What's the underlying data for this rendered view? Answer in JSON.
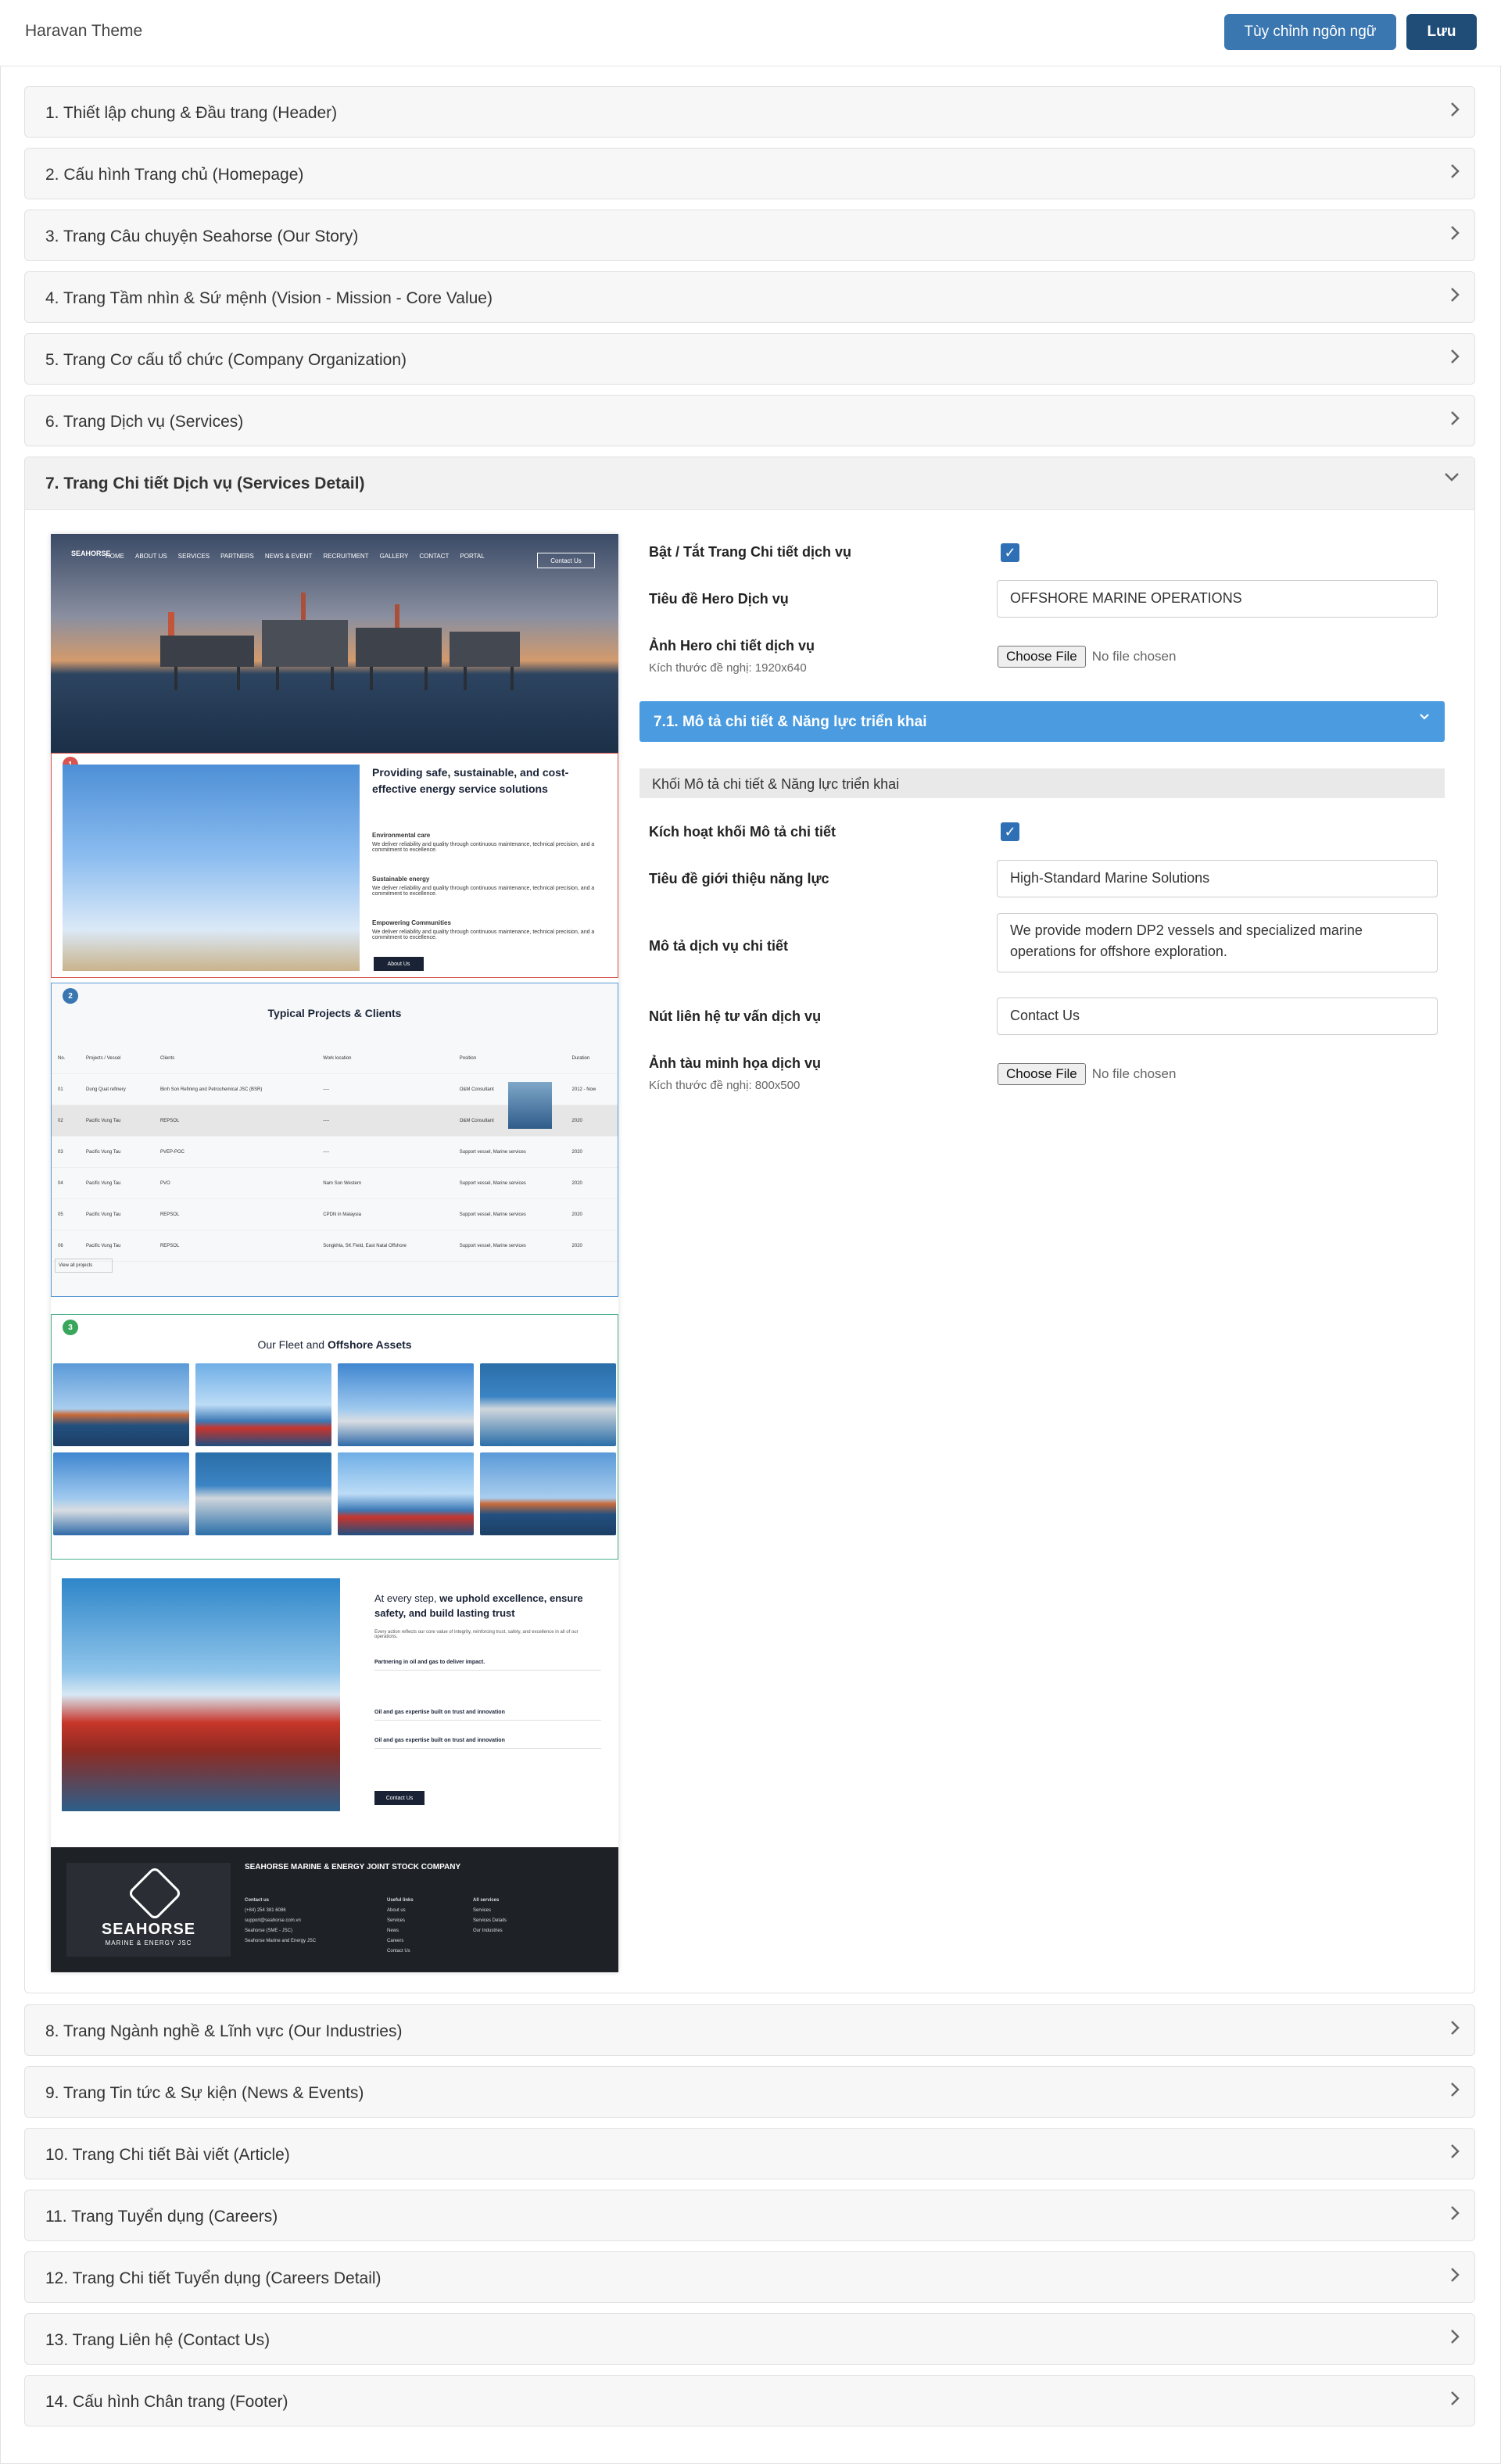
{
  "header": {
    "title": "Haravan Theme",
    "lang_button": "Tùy chỉnh ngôn ngữ",
    "save_button": "Lưu"
  },
  "sections_before": [
    "1. Thiết lập chung & Đầu trang (Header)",
    "2. Cấu hình Trang chủ (Homepage)",
    "3. Trang Câu chuyện Seahorse (Our Story)",
    "4. Trang Tầm nhìn & Sứ mệnh (Vision - Mission - Core Value)",
    "5. Trang Cơ cấu tổ chức (Company Organization)",
    "6. Trang Dịch vụ (Services)"
  ],
  "open_section": {
    "title": "7. Trang Chi tiết Dịch vụ (Services Detail)",
    "fields": {
      "toggle_label": "Bật / Tắt Trang Chi tiết dịch vụ",
      "hero_title_label": "Tiêu đề Hero Dịch vụ",
      "hero_title_value": "OFFSHORE MARINE OPERATIONS",
      "hero_image_label": "Ảnh Hero chi tiết dịch vụ",
      "hero_image_hint": "Kích thước đề nghị: 1920x640",
      "choose_file": "Choose File",
      "no_file": "No file chosen"
    },
    "subsection": {
      "title": "7.1. Mô tả chi tiết & Năng lực triển khai",
      "block_heading": "Khối Mô tả chi tiết & Năng lực triển khai",
      "activate_label": "Kích hoạt khối Mô tả chi tiết",
      "intro_label": "Tiêu đề giới thiệu năng lực",
      "intro_value": "High-Standard Marine Solutions",
      "desc_label": "Mô tả dịch vụ chi tiết",
      "desc_value": "We provide modern DP2 vessels and specialized marine operations for offshore exploration.",
      "contact_label": "Nút liên hệ tư vấn dịch vụ",
      "contact_value": "Contact Us",
      "ship_image_label": "Ảnh tàu minh họa dịch vụ",
      "ship_image_hint": "Kích thước đề nghị: 800x500"
    },
    "preview": {
      "nav_logo": "SEAHORSE",
      "nav": [
        "HOME",
        "ABOUT US",
        "SERVICES",
        "PARTNERS",
        "NEWS & EVENT",
        "RECRUITMENT",
        "GALLERY",
        "CONTACT",
        "PORTAL"
      ],
      "nav_cta": "Contact Us",
      "s1_title": "Providing safe, sustainable, and cost-effective energy service solutions",
      "s1_items": [
        {
          "title": "Environmental care",
          "text": "We deliver reliability and quality through continuous maintenance, technical precision, and a commitment to excellence."
        },
        {
          "title": "Sustainable energy",
          "text": "We deliver reliability and quality through continuous maintenance, technical precision, and a commitment to excellence."
        },
        {
          "title": "Empowering Communities",
          "text": "We deliver reliability and quality through continuous maintenance, technical precision, and a commitment to excellence."
        }
      ],
      "s1_button": "About Us",
      "s2_title": "Typical Projects & Clients",
      "s2_headers": [
        "No.",
        "Projects / Vessel",
        "Clients",
        "Work location",
        "Position",
        "Duration"
      ],
      "s2_rows": [
        [
          "01",
          "Dung Quat refinery",
          "Binh Son Refining and Petrochemical JSC (BSR)",
          "----",
          "O&M Consultant",
          "2012 - Now"
        ],
        [
          "02",
          "Pacific Vung Tau",
          "REPSOL",
          "----",
          "O&M Consultant",
          "2020"
        ],
        [
          "03",
          "Pacific Vung Tau",
          "PVEP-POC",
          "----",
          "Support vessel, Marine services",
          "2020"
        ],
        [
          "04",
          "Pacific Vung Tau",
          "PVO",
          "Nam Son Western",
          "Support vessel, Marine services",
          "2020"
        ],
        [
          "05",
          "Pacific Vung Tau",
          "REPSOL",
          "CPDN in Malaysia",
          "Support vessel, Marine services",
          "2020"
        ],
        [
          "06",
          "Pacific Vung Tau",
          "REPSOL",
          "Songkhla, SK Field, East Natal Offshore",
          "Support vessel, Marine services",
          "2020"
        ]
      ],
      "s2_more": "View all projects",
      "s3_title_a": "Our Fleet and",
      "s3_title_b": "Offshore Assets",
      "s4_title_a": "At every step,",
      "s4_title_b": "we uphold excellence, ensure safety, and build lasting trust",
      "s4_text": "Every action reflects our core value of integrity, reinforcing trust, safety, and excellence in all of our operations.",
      "s4_rows": [
        "Partnering in oil and gas to deliver impact.",
        "Oil and gas expertise built on trust and innovation",
        "Oil and gas expertise built on trust and innovation"
      ],
      "s4_button": "Contact Us",
      "footer_name": "SEAHORSE",
      "footer_sub": "MARINE & ENERGY JSC",
      "footer_company": "SEAHORSE MARINE & ENERGY JOINT STOCK COMPANY",
      "footer_contact_head": "Contact us",
      "footer_contact": [
        "(+84) 254 381 6086",
        "support@seahorse.com.vn",
        "Seahorse (SME - JSC)",
        "Seahorse Marine and Energy JSC"
      ],
      "footer_links_head": "Useful links",
      "footer_links": [
        "About us",
        "Services",
        "News",
        "Careers",
        "Contact Us"
      ],
      "footer_services_head": "All services",
      "footer_services": [
        "Services",
        "Services Details",
        "Our Industries"
      ]
    }
  },
  "sections_after": [
    "8. Trang Ngành nghề & Lĩnh vực (Our Industries)",
    "9. Trang Tin tức & Sự kiện (News & Events)",
    "10. Trang Chi tiết Bài viết (Article)",
    "11. Trang Tuyển dụng (Careers)",
    "12. Trang Chi tiết Tuyển dụng (Careers Detail)",
    "13. Trang Liên hệ (Contact Us)",
    "14. Cấu hình Chân trang (Footer)"
  ],
  "colors": {
    "primary": "#3a76b0",
    "save": "#1f4d78",
    "sub_accordion": "#4a9be0"
  }
}
